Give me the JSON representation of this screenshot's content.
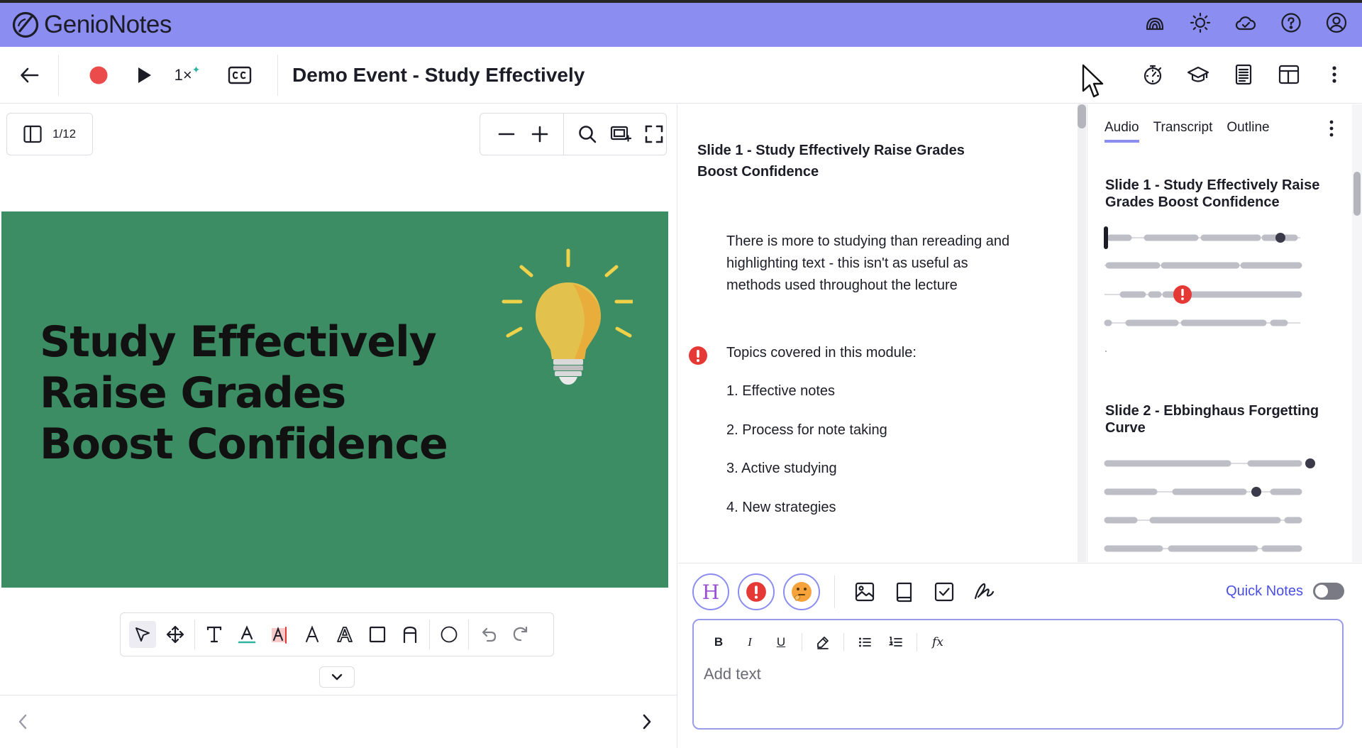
{
  "app": {
    "name_part1": "Genio",
    "name_part2": "Notes"
  },
  "toolbar": {
    "speed": "1×",
    "doc_title": "Demo Event - Study Effectively"
  },
  "viewer": {
    "page_indicator": "1/12",
    "slide": {
      "title_lines": [
        "Study Effectively",
        "Raise Grades",
        "Boost Confidence"
      ],
      "background": "#3c8c64"
    }
  },
  "notes": {
    "heading": "Slide 1 - Study Effectively Raise Grades Boost Confidence",
    "paragraph": "There is more to studying than rereading and highlighting text - this isn't as useful as methods used throughout the lecture",
    "topics_label": "Topics covered in this module:",
    "items": [
      "1. Effective notes",
      "2. Process for note taking",
      "3. Active studying",
      "4. New strategies"
    ]
  },
  "audio": {
    "tabs": [
      "Audio",
      "Transcript",
      "Outline"
    ],
    "active_tab": "Audio",
    "slide_titles": [
      "Slide 1 - Study Effectively Raise Grades Boost Confidence",
      "Slide 2 - Ebbinghaus Forgetting Curve"
    ]
  },
  "editor": {
    "tag_h": "H",
    "quick_notes_label": "Quick Notes",
    "quick_notes_on": false,
    "placeholder": "Add text"
  },
  "colors": {
    "brand": "#8b8ef0",
    "record": "#ec4b4b",
    "accent_text": "#4a4fe0",
    "alert": "#e53935"
  }
}
